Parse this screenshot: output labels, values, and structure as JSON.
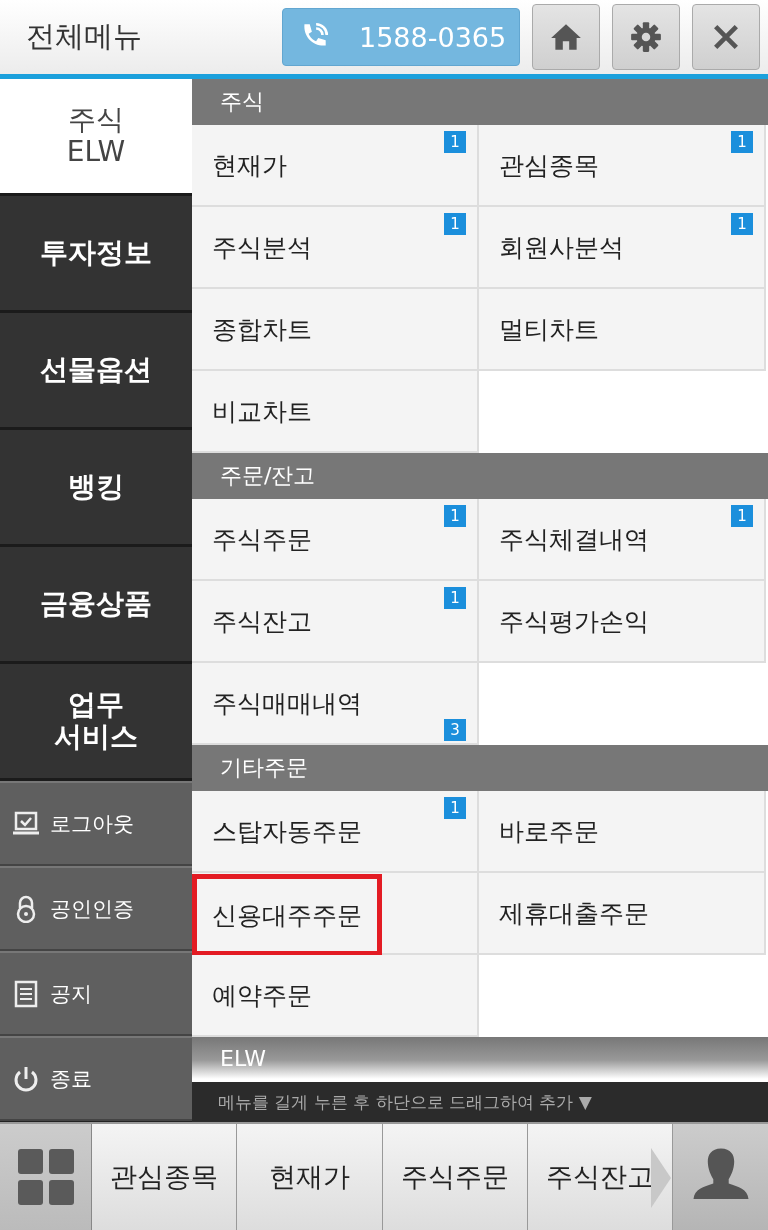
{
  "header": {
    "title": "전체메뉴",
    "phone": "1588-0365"
  },
  "categories": [
    {
      "label": "주식\nELW",
      "selected": true
    },
    {
      "label": "투자정보",
      "selected": false
    },
    {
      "label": "선물옵션",
      "selected": false
    },
    {
      "label": "뱅킹",
      "selected": false
    },
    {
      "label": "금융상품",
      "selected": false
    },
    {
      "label": "업무\n서비스",
      "selected": false
    }
  ],
  "utilities": [
    {
      "kind": "logout",
      "label": "로그아웃"
    },
    {
      "kind": "certificate",
      "label": "공인인증"
    },
    {
      "kind": "notice",
      "label": "공지"
    },
    {
      "kind": "exit",
      "label": "종료"
    }
  ],
  "sections": [
    {
      "title": "주식",
      "items": [
        {
          "label": "현재가",
          "badge": "1",
          "badge_at_bottom": false,
          "highlighted": false
        },
        {
          "label": "관심종목",
          "badge": "1",
          "badge_at_bottom": false,
          "highlighted": false
        },
        {
          "label": "주식분석",
          "badge": "1",
          "badge_at_bottom": false,
          "highlighted": false
        },
        {
          "label": "회원사분석",
          "badge": "1",
          "badge_at_bottom": false,
          "highlighted": false
        },
        {
          "label": "종합차트",
          "highlighted": false
        },
        {
          "label": "멀티차트",
          "highlighted": false
        },
        {
          "label": "비교차트",
          "highlighted": false
        }
      ]
    },
    {
      "title": "주문/잔고",
      "items": [
        {
          "label": "주식주문",
          "badge": "1",
          "badge_at_bottom": false,
          "highlighted": false
        },
        {
          "label": "주식체결내역",
          "badge": "1",
          "badge_at_bottom": false,
          "highlighted": false
        },
        {
          "label": "주식잔고",
          "badge": "1",
          "badge_at_bottom": false,
          "highlighted": false
        },
        {
          "label": "주식평가손익",
          "highlighted": false
        },
        {
          "label": "주식매매내역",
          "badge": "3",
          "badge_at_bottom": true,
          "highlighted": false
        }
      ]
    },
    {
      "title": "기타주문",
      "items": [
        {
          "label": "스탑자동주문",
          "badge": "1",
          "badge_at_bottom": false,
          "highlighted": false
        },
        {
          "label": "바로주문",
          "highlighted": false
        },
        {
          "label": "신용대주주문",
          "highlighted": true
        },
        {
          "label": "제휴대출주문",
          "highlighted": false
        },
        {
          "label": "예약주문",
          "highlighted": false
        }
      ]
    },
    {
      "title": "ELW"
    }
  ],
  "hint": "메뉴를 길게 누른 후 하단으로 드래그하여 추가 ▼",
  "quick_bar": [
    "관심종목",
    "현재가",
    "주식주문",
    "주식잔고"
  ]
}
